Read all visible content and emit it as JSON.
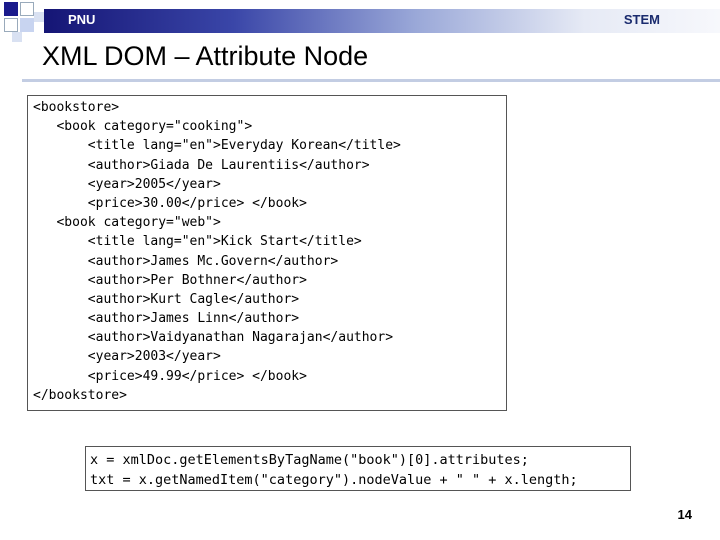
{
  "header": {
    "left_label": "PNU",
    "right_label": "STEM"
  },
  "title": "XML DOM – Attribute Node",
  "xml_lines": [
    "<bookstore>",
    "   <book category=\"cooking\">",
    "       <title lang=\"en\">Everyday Korean</title>",
    "       <author>Giada De Laurentiis</author>",
    "       <year>2005</year>",
    "       <price>30.00</price> </book>",
    "   <book category=\"web\">",
    "       <title lang=\"en\">Kick Start</title>",
    "       <author>James Mc.Govern</author>",
    "       <author>Per Bothner</author>",
    "       <author>Kurt Cagle</author>",
    "       <author>James Linn</author>",
    "       <author>Vaidyanathan Nagarajan</author>",
    "       <year>2003</year>",
    "       <price>49.99</price> </book>",
    "</bookstore>"
  ],
  "js_lines": [
    "x = xmlDoc.getElementsByTagName(\"book\")[0].attributes;",
    "txt = x.getNamedItem(\"category\").nodeValue + \" \" + x.length;"
  ],
  "page_number": "14"
}
